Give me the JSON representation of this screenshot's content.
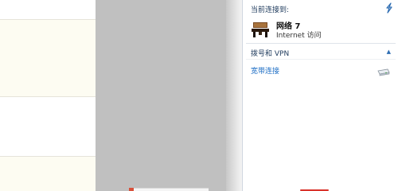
{
  "flyout": {
    "current_connection_label": "当前连接到:",
    "network": {
      "name": "网络  7",
      "status": "Internet 访问"
    },
    "dialup_section": {
      "header": "拨号和 VPN",
      "items": [
        {
          "label": "宽带连接"
        }
      ]
    }
  },
  "icons": {
    "refresh": "refresh-icon",
    "network": "network-bench-icon",
    "collapse": "chevron-up-icon",
    "modem": "modem-icon"
  },
  "colors": {
    "accent": "#1f6fc5",
    "header_text": "#1e3a5c",
    "desktop_gray": "#c0c0c0",
    "pane_cream": "#fdfcf2"
  }
}
